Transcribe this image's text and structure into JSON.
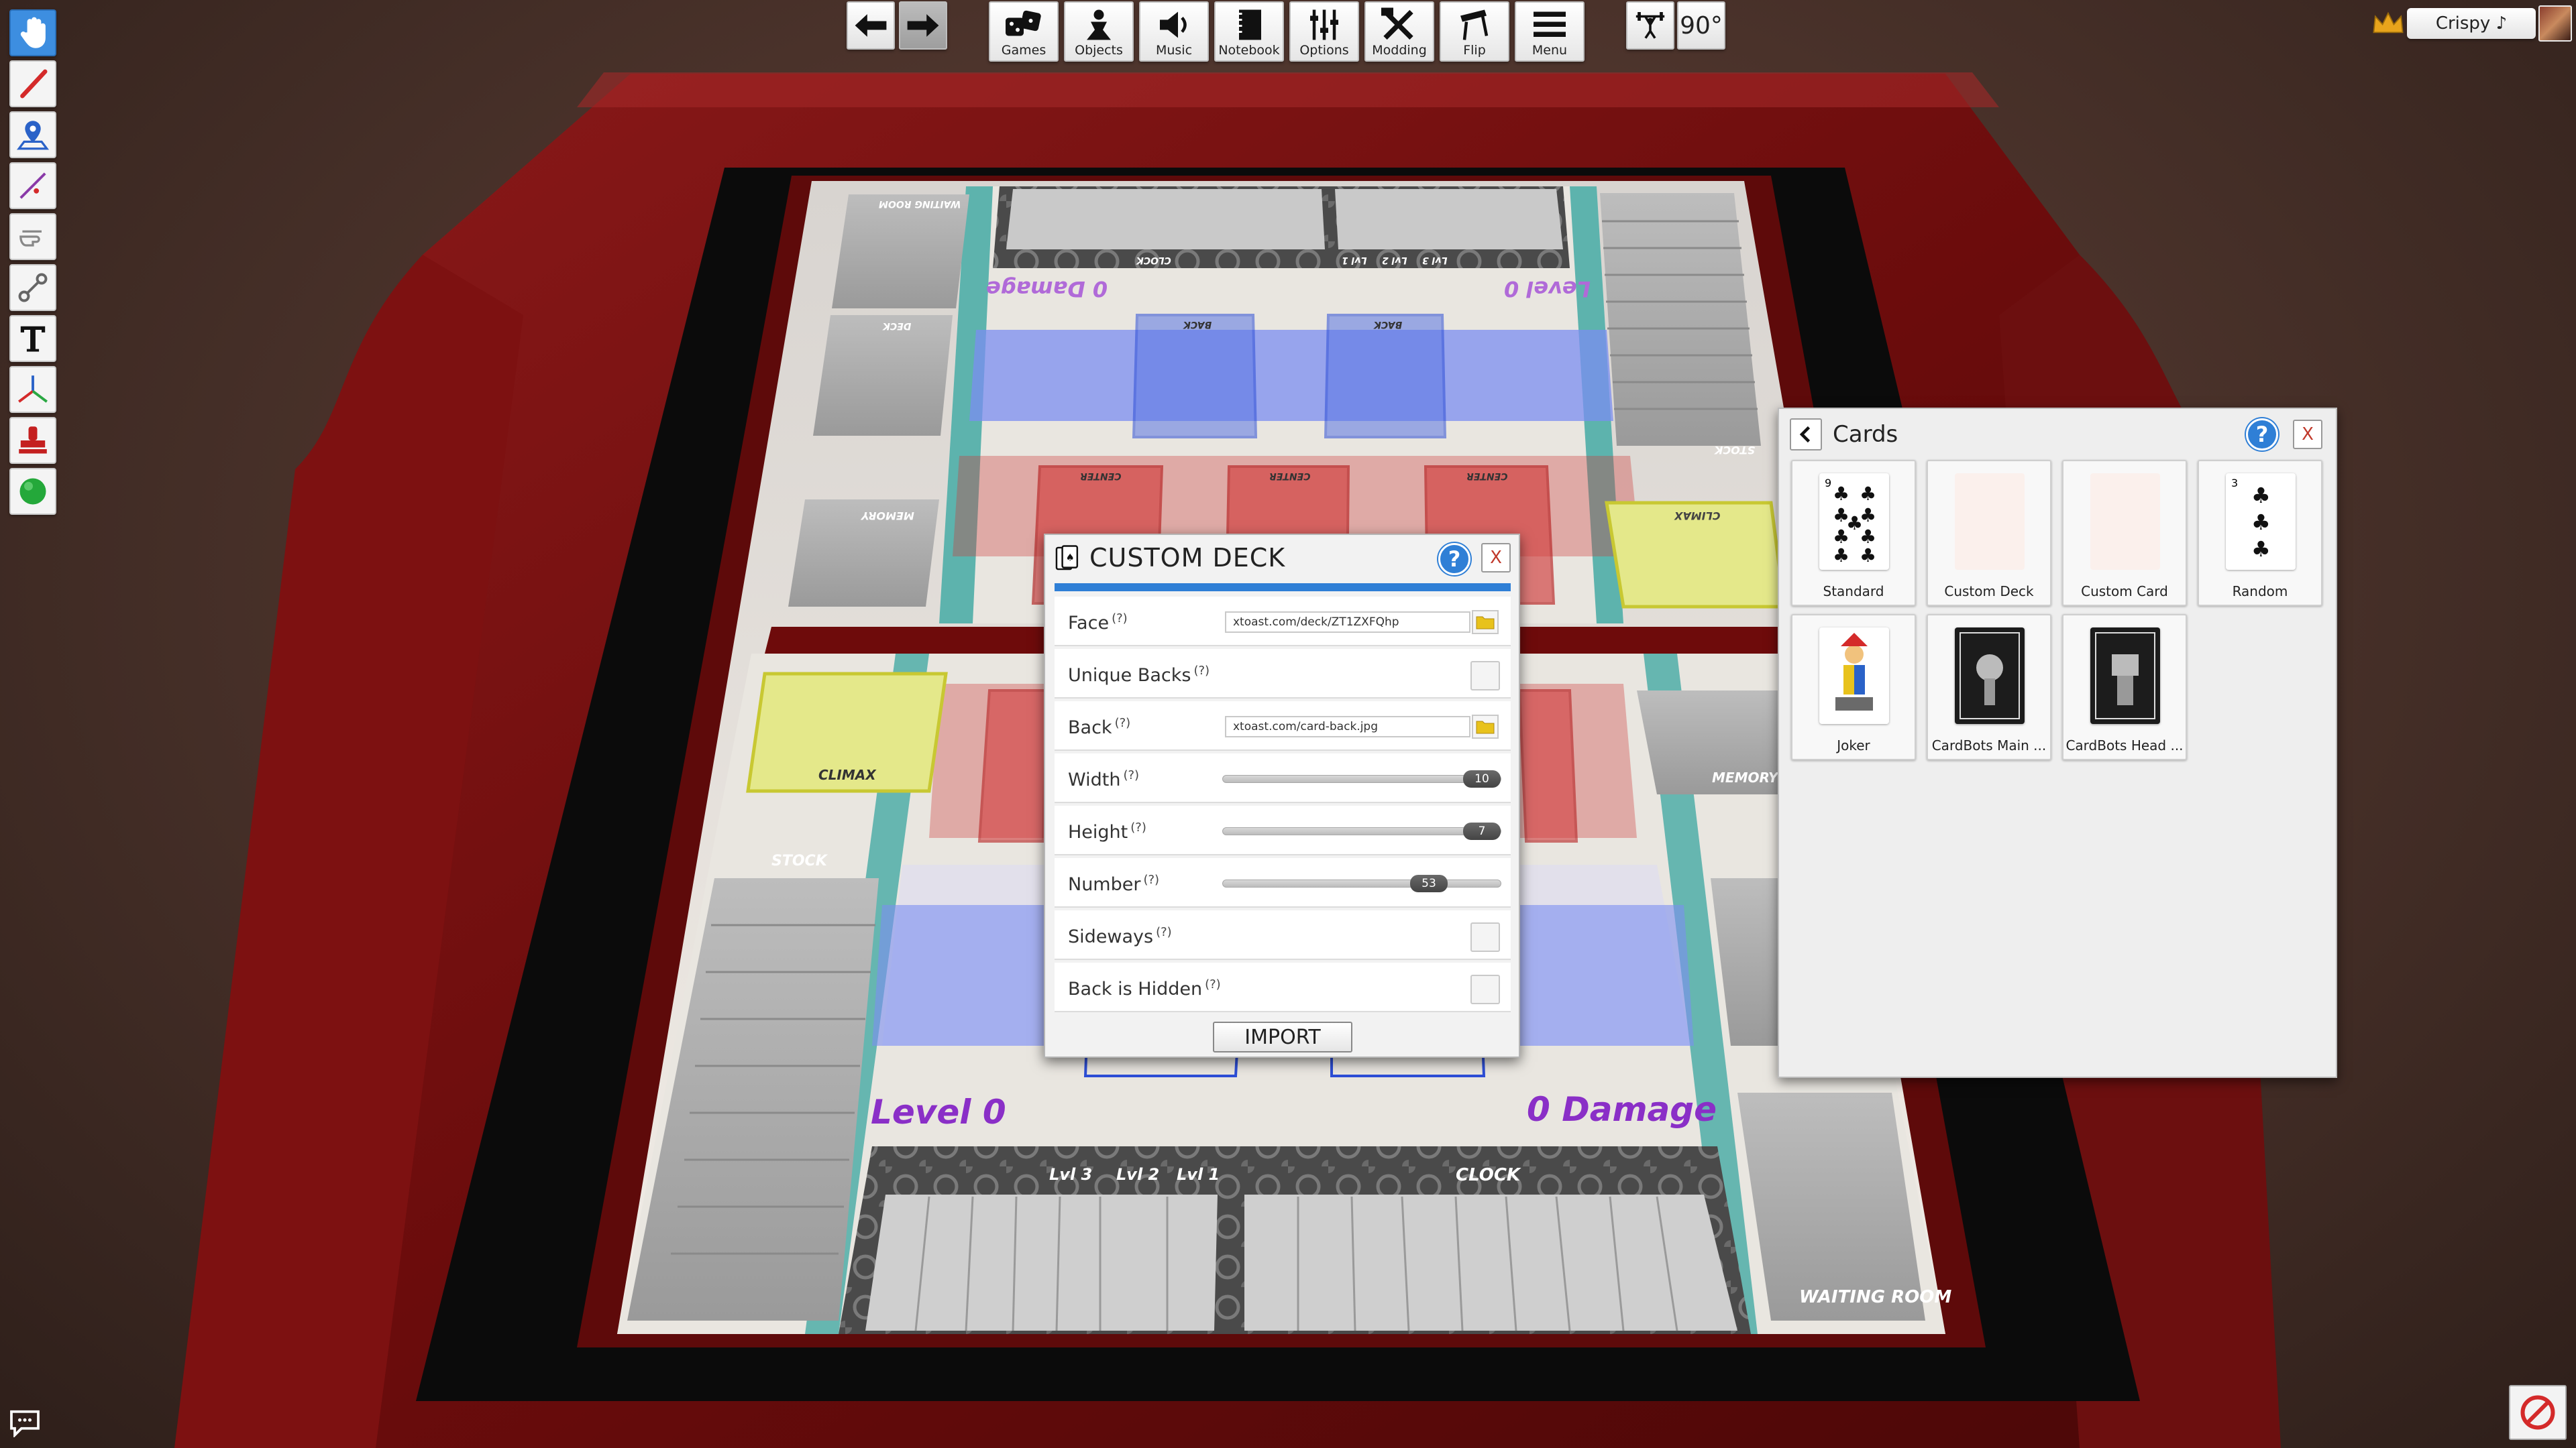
{
  "top_toolbar": {
    "undo_label": "",
    "redo_label": "",
    "buttons": [
      {
        "label": "Games",
        "icon": "dice-icon"
      },
      {
        "label": "Objects",
        "icon": "pawn-icon"
      },
      {
        "label": "Music",
        "icon": "speaker-icon"
      },
      {
        "label": "Notebook",
        "icon": "notebook-icon"
      },
      {
        "label": "Options",
        "icon": "sliders-icon"
      },
      {
        "label": "Modding",
        "icon": "tools-icon"
      },
      {
        "label": "Flip",
        "icon": "flip-table-icon"
      },
      {
        "label": "Menu",
        "icon": "hamburger-icon"
      }
    ],
    "rotation_value": "90°"
  },
  "player": {
    "name": "Crispy ♪",
    "host_icon": "crown-icon"
  },
  "left_tools": [
    {
      "icon": "grab-hand-icon",
      "active": true
    },
    {
      "icon": "pen-icon"
    },
    {
      "icon": "map-pin-icon"
    },
    {
      "icon": "line-icon"
    },
    {
      "icon": "flick-hand-icon"
    },
    {
      "icon": "joint-icon"
    },
    {
      "icon": "text-icon"
    },
    {
      "icon": "gizmo-icon"
    },
    {
      "icon": "stamp-icon"
    },
    {
      "icon": "green-sphere-icon"
    }
  ],
  "board": {
    "top_player": {
      "level_text": "Level 0",
      "damage_text": "0 Damage",
      "waiting_room": "WAITING ROOM",
      "deck": "DECK",
      "memory": "MEMORY",
      "climax": "CLIMAX",
      "stock": "STOCK",
      "clock": "CLOCK",
      "back_slots": [
        "BACK",
        "BACK"
      ],
      "center_slots": [
        "CENTER",
        "CENTER",
        "CENTER"
      ],
      "levels": [
        "Lvl 3",
        "Lvl 2",
        "Lvl 1"
      ]
    },
    "bottom_player": {
      "level_text": "Level 0",
      "damage_text": "0 Damage",
      "climax": "CLIMAX",
      "stock": "STOCK",
      "memory": "MEMORY",
      "clock": "CLOCK",
      "waiting_room": "WAITING ROOM",
      "levels": [
        "Lvl 3",
        "Lvl 2",
        "Lvl 1"
      ]
    }
  },
  "custom_deck": {
    "title": "CUSTOM DECK",
    "help": "?",
    "close": "X",
    "hint": "(?)",
    "face": {
      "label": "Face",
      "value": "xtoast.com/deck/ZT1ZXFQhp"
    },
    "unique_backs": {
      "label": "Unique Backs",
      "checked": false
    },
    "back": {
      "label": "Back",
      "value": "xtoast.com/card-back.jpg"
    },
    "width": {
      "label": "Width",
      "value": "10",
      "fraction": 1.0
    },
    "height": {
      "label": "Height",
      "value": "7",
      "fraction": 1.0
    },
    "number": {
      "label": "Number",
      "value": "53",
      "fraction": 0.78
    },
    "sideways": {
      "label": "Sideways",
      "checked": false
    },
    "back_hidden": {
      "label": "Back is Hidden",
      "checked": false
    },
    "import_label": "IMPORT"
  },
  "cards_panel": {
    "title": "Cards",
    "help": "?",
    "close": "X",
    "items": [
      {
        "name": "Standard"
      },
      {
        "name": "Custom Deck"
      },
      {
        "name": "Custom Card"
      },
      {
        "name": "Random"
      },
      {
        "name": "Joker"
      },
      {
        "name": "CardBots Main ..."
      },
      {
        "name": "CardBots Head ..."
      }
    ]
  },
  "colors": {
    "accent_blue": "#2f7fd6",
    "table_red": "#7a0d0d",
    "zone_yellow": "#e4e88a",
    "zone_red": "#d33b3b",
    "zone_blue": "#6e8cf0",
    "level_text_purple": "#8a2fc7"
  }
}
